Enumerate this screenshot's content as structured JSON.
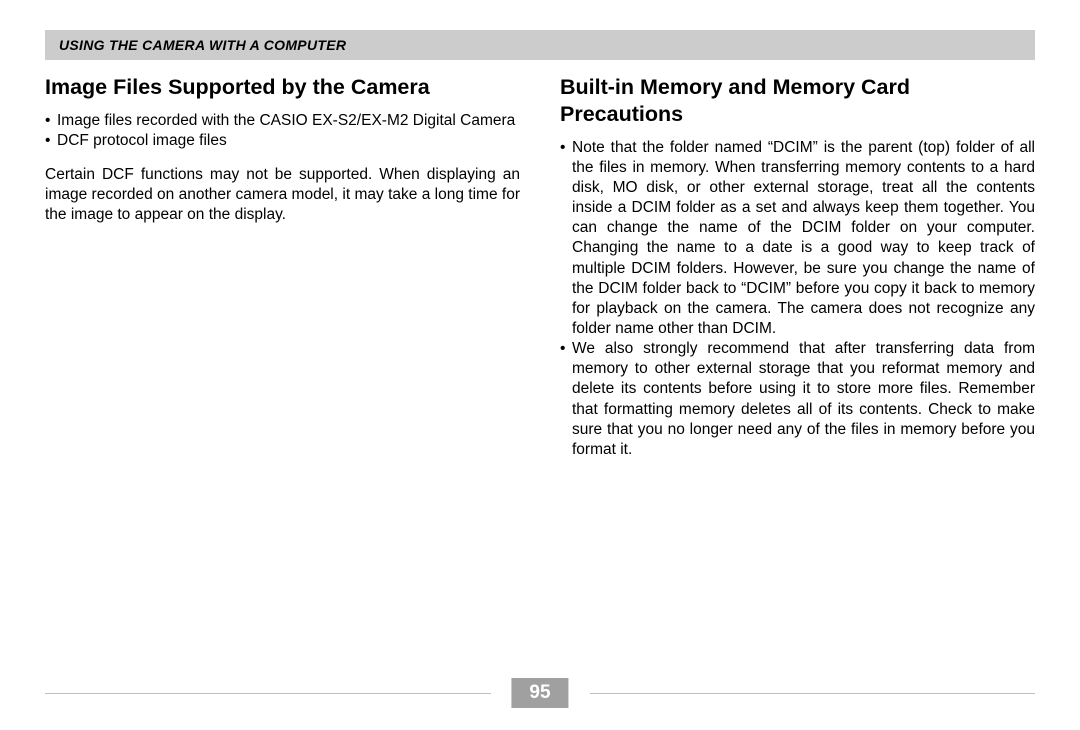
{
  "header": {
    "title": "USING THE CAMERA WITH A COMPUTER"
  },
  "left": {
    "heading": "Image Files Supported by the Camera",
    "bullets": [
      "Image files recorded with the CASIO EX-S2/EX-M2 Digital Camera",
      "DCF protocol image files"
    ],
    "paragraph": "Certain DCF functions may not be supported. When displaying an image recorded on another camera model, it may take a long time for the image to appear on the display."
  },
  "right": {
    "heading": "Built-in Memory and Memory Card Precautions",
    "bullets": [
      "Note that the folder named “DCIM” is the parent (top) folder of all the files in memory. When transferring memory contents to a hard disk, MO disk, or other external storage, treat all the contents inside a DCIM folder as a set and always keep them together. You can change the name of the DCIM folder on your computer. Changing the name to a date is a good way to keep track of multiple DCIM folders. However, be sure you change the name of the DCIM folder back to “DCIM” before you copy it back to memory for playback on the camera. The camera does not recognize any folder name other than DCIM.",
      "We also strongly recommend that after transferring data from memory to other external storage that you reformat memory and delete its contents before using it to store more files. Remember that formatting memory deletes all of its contents. Check to make sure that you no longer need any of the files in memory before you format it."
    ]
  },
  "page_number": "95"
}
